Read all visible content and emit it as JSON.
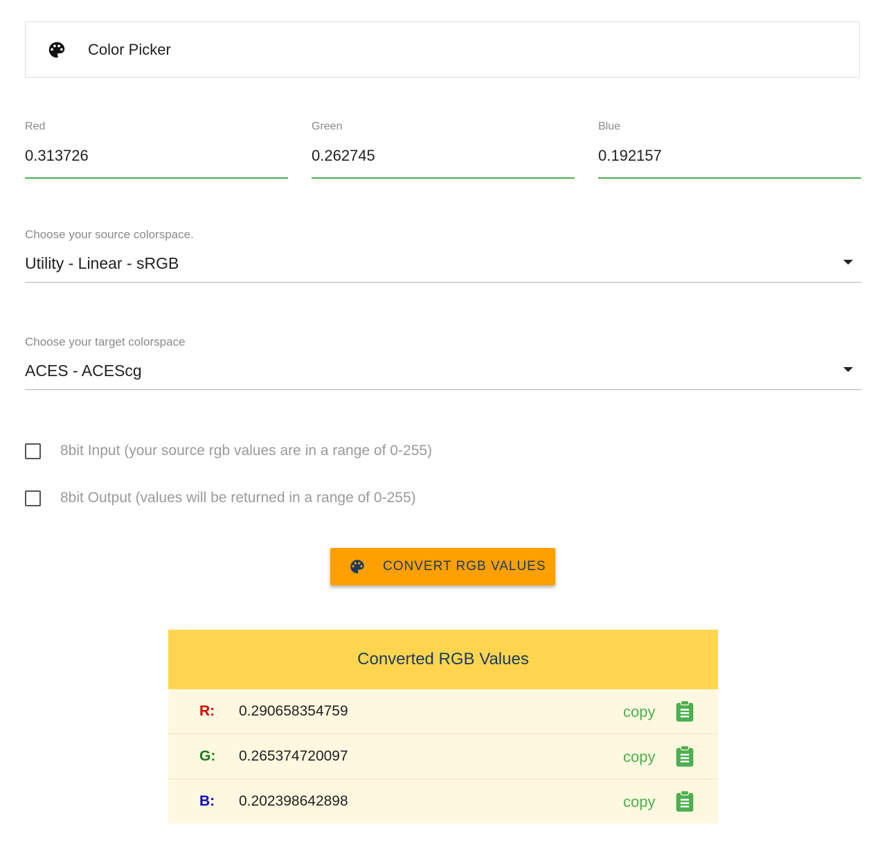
{
  "app": {
    "title": "Color Picker",
    "icon": "palette-icon"
  },
  "inputs": [
    {
      "label": "Red",
      "value": "0.313726"
    },
    {
      "label": "Green",
      "value": "0.262745"
    },
    {
      "label": "Blue",
      "value": "0.192157"
    }
  ],
  "source": {
    "label": "Choose your source colorspace.",
    "value": "Utility - Linear - sRGB"
  },
  "target": {
    "label": "Choose your target colorspace",
    "value": "ACES - ACEScg"
  },
  "options": [
    {
      "label": "8bit Input (your source rgb values are in a range of 0-255)",
      "checked": false
    },
    {
      "label": "8bit Output (values will be returned in a range of 0-255)",
      "checked": false
    }
  ],
  "convert": {
    "label": "CONVERT RGB VALUES",
    "color": "#ffa000"
  },
  "results": {
    "title": "Converted RGB Values",
    "rows": [
      {
        "channel": "R:",
        "value": "0.290658354759",
        "copy": "copy",
        "color": "#d50000"
      },
      {
        "channel": "G:",
        "value": "0.265374720097",
        "copy": "copy",
        "color": "#1b7a1b"
      },
      {
        "channel": "B:",
        "value": "0.202398642898",
        "copy": "copy",
        "color": "#0d0dbf"
      }
    ]
  },
  "colors": {
    "accent_line": "#4caf50",
    "header": "#ffd54f",
    "row_bg": "#fff8e1"
  }
}
